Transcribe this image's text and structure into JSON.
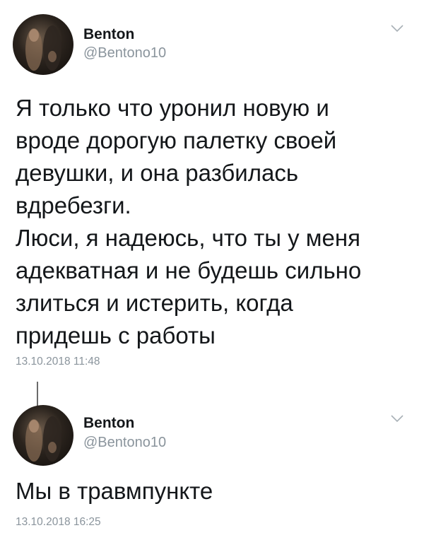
{
  "tweets": [
    {
      "name": "Benton",
      "handle": "@Bentono10",
      "text": "Я только что уронил новую и\nвроде дорогую палетку своей\nдевушки, и она разбилась\nвдребезги.\nЛюси, я надеюсь, что ты у меня\nадекватная и не будешь сильно\nзлиться и истерить, когда\nпридешь с работы",
      "timestamp": "13.10.2018  11:48"
    },
    {
      "name": "Benton",
      "handle": "@Bentono10",
      "text": "Мы в травмпункте",
      "timestamp": "13.10.2018  16:25"
    }
  ],
  "icons": {
    "avatar": "avatar",
    "menu": "chevron-down-icon"
  },
  "colors": {
    "text": "#14171a",
    "secondary": "#8a949c"
  }
}
